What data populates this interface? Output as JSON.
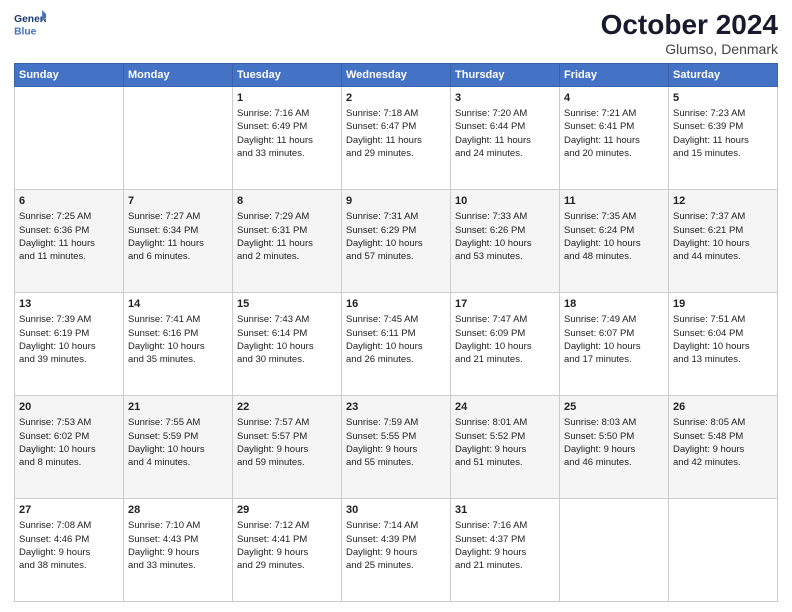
{
  "logo": {
    "line1": "General",
    "line2": "Blue"
  },
  "header": {
    "month_year": "October 2024",
    "location": "Glumso, Denmark"
  },
  "days_of_week": [
    "Sunday",
    "Monday",
    "Tuesday",
    "Wednesday",
    "Thursday",
    "Friday",
    "Saturday"
  ],
  "weeks": [
    [
      {
        "day": "",
        "content": ""
      },
      {
        "day": "",
        "content": ""
      },
      {
        "day": "1",
        "content": "Sunrise: 7:16 AM\nSunset: 6:49 PM\nDaylight: 11 hours\nand 33 minutes."
      },
      {
        "day": "2",
        "content": "Sunrise: 7:18 AM\nSunset: 6:47 PM\nDaylight: 11 hours\nand 29 minutes."
      },
      {
        "day": "3",
        "content": "Sunrise: 7:20 AM\nSunset: 6:44 PM\nDaylight: 11 hours\nand 24 minutes."
      },
      {
        "day": "4",
        "content": "Sunrise: 7:21 AM\nSunset: 6:41 PM\nDaylight: 11 hours\nand 20 minutes."
      },
      {
        "day": "5",
        "content": "Sunrise: 7:23 AM\nSunset: 6:39 PM\nDaylight: 11 hours\nand 15 minutes."
      }
    ],
    [
      {
        "day": "6",
        "content": "Sunrise: 7:25 AM\nSunset: 6:36 PM\nDaylight: 11 hours\nand 11 minutes."
      },
      {
        "day": "7",
        "content": "Sunrise: 7:27 AM\nSunset: 6:34 PM\nDaylight: 11 hours\nand 6 minutes."
      },
      {
        "day": "8",
        "content": "Sunrise: 7:29 AM\nSunset: 6:31 PM\nDaylight: 11 hours\nand 2 minutes."
      },
      {
        "day": "9",
        "content": "Sunrise: 7:31 AM\nSunset: 6:29 PM\nDaylight: 10 hours\nand 57 minutes."
      },
      {
        "day": "10",
        "content": "Sunrise: 7:33 AM\nSunset: 6:26 PM\nDaylight: 10 hours\nand 53 minutes."
      },
      {
        "day": "11",
        "content": "Sunrise: 7:35 AM\nSunset: 6:24 PM\nDaylight: 10 hours\nand 48 minutes."
      },
      {
        "day": "12",
        "content": "Sunrise: 7:37 AM\nSunset: 6:21 PM\nDaylight: 10 hours\nand 44 minutes."
      }
    ],
    [
      {
        "day": "13",
        "content": "Sunrise: 7:39 AM\nSunset: 6:19 PM\nDaylight: 10 hours\nand 39 minutes."
      },
      {
        "day": "14",
        "content": "Sunrise: 7:41 AM\nSunset: 6:16 PM\nDaylight: 10 hours\nand 35 minutes."
      },
      {
        "day": "15",
        "content": "Sunrise: 7:43 AM\nSunset: 6:14 PM\nDaylight: 10 hours\nand 30 minutes."
      },
      {
        "day": "16",
        "content": "Sunrise: 7:45 AM\nSunset: 6:11 PM\nDaylight: 10 hours\nand 26 minutes."
      },
      {
        "day": "17",
        "content": "Sunrise: 7:47 AM\nSunset: 6:09 PM\nDaylight: 10 hours\nand 21 minutes."
      },
      {
        "day": "18",
        "content": "Sunrise: 7:49 AM\nSunset: 6:07 PM\nDaylight: 10 hours\nand 17 minutes."
      },
      {
        "day": "19",
        "content": "Sunrise: 7:51 AM\nSunset: 6:04 PM\nDaylight: 10 hours\nand 13 minutes."
      }
    ],
    [
      {
        "day": "20",
        "content": "Sunrise: 7:53 AM\nSunset: 6:02 PM\nDaylight: 10 hours\nand 8 minutes."
      },
      {
        "day": "21",
        "content": "Sunrise: 7:55 AM\nSunset: 5:59 PM\nDaylight: 10 hours\nand 4 minutes."
      },
      {
        "day": "22",
        "content": "Sunrise: 7:57 AM\nSunset: 5:57 PM\nDaylight: 9 hours\nand 59 minutes."
      },
      {
        "day": "23",
        "content": "Sunrise: 7:59 AM\nSunset: 5:55 PM\nDaylight: 9 hours\nand 55 minutes."
      },
      {
        "day": "24",
        "content": "Sunrise: 8:01 AM\nSunset: 5:52 PM\nDaylight: 9 hours\nand 51 minutes."
      },
      {
        "day": "25",
        "content": "Sunrise: 8:03 AM\nSunset: 5:50 PM\nDaylight: 9 hours\nand 46 minutes."
      },
      {
        "day": "26",
        "content": "Sunrise: 8:05 AM\nSunset: 5:48 PM\nDaylight: 9 hours\nand 42 minutes."
      }
    ],
    [
      {
        "day": "27",
        "content": "Sunrise: 7:08 AM\nSunset: 4:46 PM\nDaylight: 9 hours\nand 38 minutes."
      },
      {
        "day": "28",
        "content": "Sunrise: 7:10 AM\nSunset: 4:43 PM\nDaylight: 9 hours\nand 33 minutes."
      },
      {
        "day": "29",
        "content": "Sunrise: 7:12 AM\nSunset: 4:41 PM\nDaylight: 9 hours\nand 29 minutes."
      },
      {
        "day": "30",
        "content": "Sunrise: 7:14 AM\nSunset: 4:39 PM\nDaylight: 9 hours\nand 25 minutes."
      },
      {
        "day": "31",
        "content": "Sunrise: 7:16 AM\nSunset: 4:37 PM\nDaylight: 9 hours\nand 21 minutes."
      },
      {
        "day": "",
        "content": ""
      },
      {
        "day": "",
        "content": ""
      }
    ]
  ]
}
